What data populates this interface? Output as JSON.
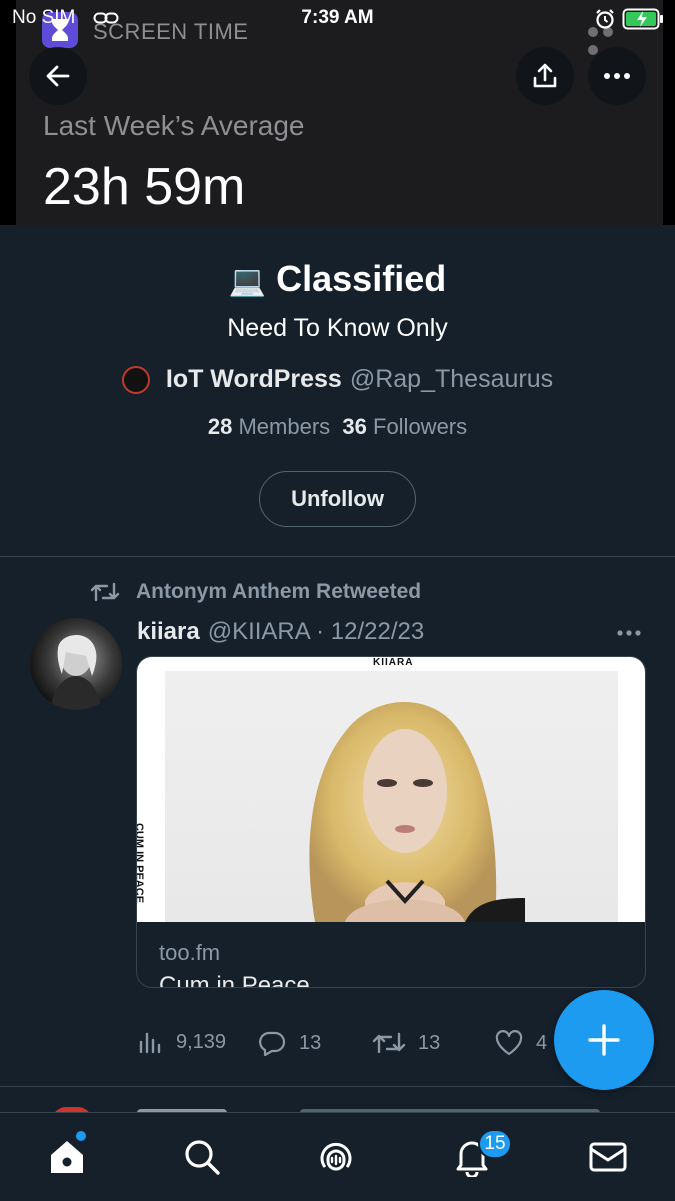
{
  "status_bar": {
    "carrier": "No SIM",
    "time": "7:39 AM"
  },
  "banner": {
    "app_name": "SCREEN TIME",
    "subtitle": "Last Week’s Average",
    "value": "23h 59m"
  },
  "list": {
    "title": "Classified",
    "title_emoji": "💻",
    "description": "Need To Know Only",
    "owner_name": "IoT WordPress",
    "owner_handle": "@Rap_Thesaurus",
    "members_count": "28",
    "members_label": "Members",
    "followers_count": "36",
    "followers_label": "Followers",
    "unfollow_label": "Unfollow"
  },
  "tweet": {
    "retweeted_by": "Antonym Anthem Retweeted",
    "author_name": "kiiara",
    "author_handle": "@KIIARA",
    "date": "· 12/22/23",
    "card_domain": "too.fm",
    "card_title": "Cum in Peace",
    "card_top_text": "KIIARA",
    "card_side_text": "CUM IN PEACE",
    "views": "9,139",
    "replies": "13",
    "retweets": "13",
    "likes": "4"
  },
  "tab_bar": {
    "notifications_badge": "15"
  },
  "colors": {
    "background": "#15202b",
    "accent": "#1d9bf0",
    "muted_text": "#8b98a5"
  }
}
